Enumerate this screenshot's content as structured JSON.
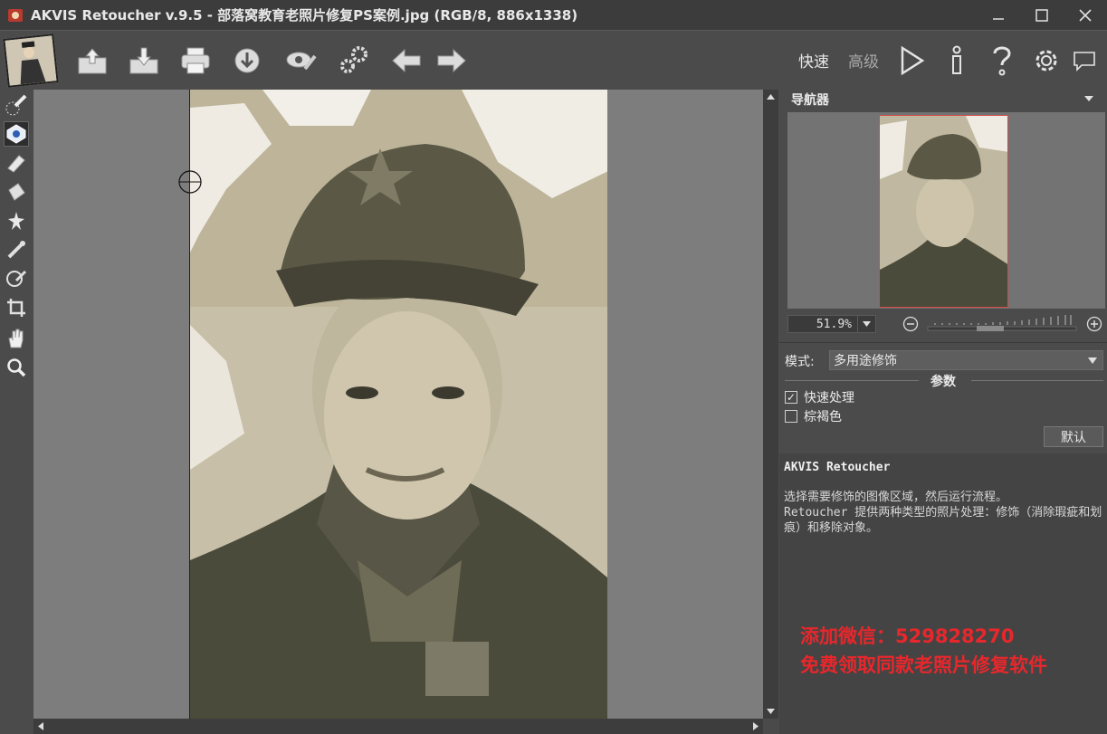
{
  "window": {
    "title": "AKVIS Retoucher v.9.5 - 部落窝教育老照片修复PS案例.jpg (RGB/8, 886x1338)",
    "minimize": "minimize-icon",
    "maximize": "maximize-icon",
    "close": "close-icon"
  },
  "toolbar": {
    "icons": [
      "open-icon",
      "save-icon",
      "print-icon",
      "share-icon",
      "preferences-icon",
      "batch-icon",
      "undo-icon",
      "redo-icon"
    ],
    "mode_express": "快速",
    "mode_advanced": "高级",
    "right_icons": [
      "run-icon",
      "info-icon",
      "help-icon",
      "settings-icon",
      "notification-icon"
    ]
  },
  "left_tools": [
    "retouch-brush-icon",
    "selection-brush-icon",
    "eraser-icon",
    "bucket-icon",
    "magic-wand-icon",
    "clone-stamp-icon",
    "chameleon-brush-icon",
    "crop-icon",
    "hand-icon",
    "zoom-icon"
  ],
  "navigator": {
    "label": "导航器",
    "zoom_value": "51.9%"
  },
  "settings": {
    "mode_label": "模式:",
    "mode_value": "多用途修饰",
    "params_title": "参数",
    "quick_processing_label": "快速处理",
    "quick_processing_checked": true,
    "sepia_label": "棕褐色",
    "sepia_checked": false,
    "default_button": "默认"
  },
  "help": {
    "title": "AKVIS Retoucher",
    "line1": "选择需要修饰的图像区域，然后运行流程。",
    "line2": "Retoucher 提供两种类型的照片处理：修饰（消除瑕疵和划痕）和移除对象。"
  },
  "watermark": {
    "line1": "添加微信：529828270",
    "line2": "免费领取同款老照片修复软件"
  },
  "colors": {
    "accent_red": "#e8272c",
    "panel_bg": "#4b4b4b",
    "canvas_bg": "#7d7d7d"
  }
}
